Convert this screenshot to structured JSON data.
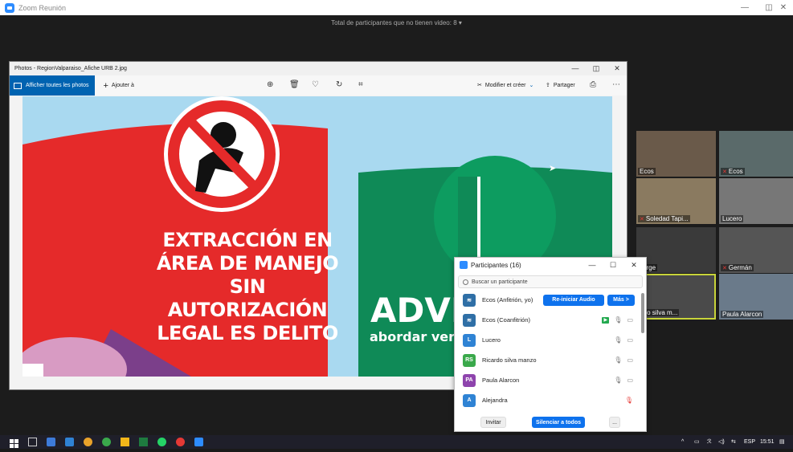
{
  "zoom": {
    "window_title": "Zoom Reunión",
    "top_banner": "Total de participantes que no tienen video: 8"
  },
  "photos": {
    "window_title": "Photos - RegionValparaiso_Afiche URB 2.jpg",
    "all_photos_label": "Afficher toutes les photos",
    "add_to_label": "Ajouter à",
    "edit_create_label": "Modifier et créer",
    "share_label": "Partager",
    "poster": {
      "left_text": [
        "EXTRACCIÓN EN",
        "ÁREA DE MANEJO",
        "SIN AUTORIZACIÓN",
        "LEGAL ES DELITO"
      ],
      "right_big": "ADVI",
      "right_small": "abordar ver",
      "number": "1",
      "colors": {
        "sky": "#a9d9f0",
        "red": "#e52a2a",
        "green": "#0f8a57",
        "purple": "#7b3f8a"
      }
    }
  },
  "thumbnails": [
    {
      "name": "Ecos",
      "muted": false
    },
    {
      "name": "Ecos",
      "muted": true
    },
    {
      "name": "Soledad Tapi...",
      "muted": true
    },
    {
      "name": "Lucero",
      "muted": false
    },
    {
      "name": "Jorge",
      "muted": false
    },
    {
      "name": "Germán",
      "muted": true
    },
    {
      "name": "rdo silva m...",
      "muted": false
    },
    {
      "name": "Paula Alarcon",
      "muted": false
    }
  ],
  "participants": {
    "title": "Participantes (16)",
    "search_placeholder": "Buscar un participante",
    "rows": [
      {
        "initials": "",
        "name": "Ecos (Anfitrión, yo)",
        "color": "#2f6fa6"
      },
      {
        "initials": "",
        "name": "Ecos (Coanfitrión)",
        "color": "#2f6fa6"
      },
      {
        "initials": "L",
        "name": "Lucero",
        "color": "#2f83d4"
      },
      {
        "initials": "RS",
        "name": "Ricardo silva manzo",
        "color": "#3aa94b"
      },
      {
        "initials": "PA",
        "name": "Paula Alarcon",
        "color": "#8e44ad"
      },
      {
        "initials": "A",
        "name": "Alejandra",
        "color": "#2f83d4"
      }
    ],
    "reinit_audio": "Re-iniciar Audio",
    "more": "Más >",
    "invite": "Invitar",
    "mute_all": "Silenciar a todos",
    "ellipsis": "..."
  },
  "taskbar": {
    "lang": "ESP",
    "time": "15:51"
  }
}
